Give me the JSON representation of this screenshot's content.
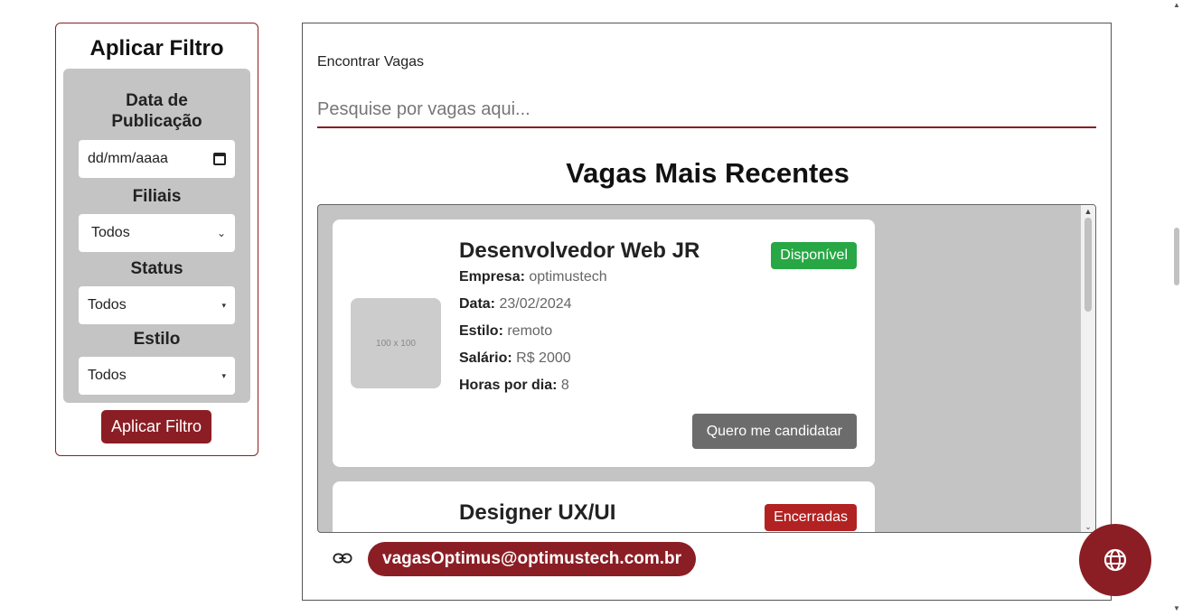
{
  "filter": {
    "title": "Aplicar Filtro",
    "date_label": "Data de Publicação",
    "date_placeholder": "dd/mm/aaaa",
    "branches_label": "Filiais",
    "branches_value": "Todos",
    "status_label": "Status",
    "status_value": "Todos",
    "style_label": "Estilo",
    "style_value": "Todos",
    "apply_button": "Aplicar Filtro"
  },
  "search": {
    "label": "Encontrar Vagas",
    "placeholder": "Pesquise por vagas aqui..."
  },
  "section_title": "Vagas Mais Recentes",
  "jobs": [
    {
      "thumb_text": "100 x 100",
      "title": "Desenvolvedor Web JR",
      "status": "Disponível",
      "status_color": "#28a745",
      "company_label": "Empresa:",
      "company": "optimustech",
      "date_label": "Data:",
      "date": "23/02/2024",
      "style_label": "Estilo:",
      "style": "remoto",
      "salary_label": "Salário:",
      "salary": "R$ 2000",
      "hours_label": "Horas por dia:",
      "hours": "8",
      "apply_button": "Quero me candidatar"
    },
    {
      "title": "Designer UX/UI",
      "status": "Encerradas",
      "status_color": "#b22222"
    }
  ],
  "contact": {
    "email": "vagasOptimus@optimustech.com.br",
    "icon": "link-icon"
  },
  "colors": {
    "brand": "#8b1e24",
    "available": "#28a745",
    "closed": "#b22222"
  },
  "fab_icon": "globe-icon"
}
